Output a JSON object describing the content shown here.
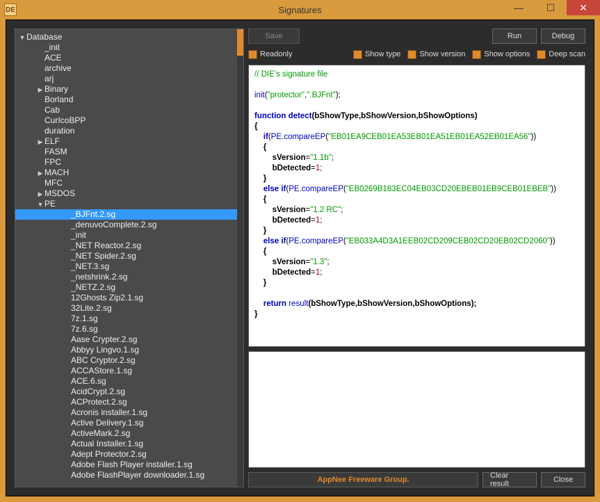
{
  "window": {
    "title": "Signatures",
    "app_icon_text": "DE"
  },
  "buttons": {
    "save": "Save",
    "run": "Run",
    "debug": "Debug",
    "clear_result": "Clear result",
    "close": "Close"
  },
  "options": {
    "readonly": "Readonly",
    "show_type": "Show type",
    "show_version": "Show version",
    "show_options": "Show options",
    "deep_scan": "Deep scan"
  },
  "status": {
    "text": "AppNee Freeware Group."
  },
  "tree": {
    "root": {
      "label": "Database",
      "expanded": true
    },
    "items": [
      {
        "label": "_init",
        "depth": 1
      },
      {
        "label": "ACE",
        "depth": 1
      },
      {
        "label": "archive",
        "depth": 1
      },
      {
        "label": "arj",
        "depth": 1
      },
      {
        "label": "Binary",
        "depth": 1,
        "expandable": true
      },
      {
        "label": "Borland",
        "depth": 1
      },
      {
        "label": "Cab",
        "depth": 1
      },
      {
        "label": "CurIcoBPP",
        "depth": 1
      },
      {
        "label": "duration",
        "depth": 1
      },
      {
        "label": "ELF",
        "depth": 1,
        "expandable": true
      },
      {
        "label": "FASM",
        "depth": 1
      },
      {
        "label": "FPC",
        "depth": 1
      },
      {
        "label": "MACH",
        "depth": 1,
        "expandable": true
      },
      {
        "label": "MFC",
        "depth": 1
      },
      {
        "label": "MSDOS",
        "depth": 1,
        "expandable": true
      },
      {
        "label": "PE",
        "depth": 1,
        "expandable": true,
        "expanded": true
      },
      {
        "label": "_BJFnt.2.sg",
        "depth": 2,
        "selected": true
      },
      {
        "label": "_denuvoComplete.2.sg",
        "depth": 2
      },
      {
        "label": "_init",
        "depth": 2
      },
      {
        "label": "_NET Reactor.2.sg",
        "depth": 2
      },
      {
        "label": "_NET Spider.2.sg",
        "depth": 2
      },
      {
        "label": "_NET.3.sg",
        "depth": 2
      },
      {
        "label": "_netshrink.2.sg",
        "depth": 2
      },
      {
        "label": "_NETZ.2.sg",
        "depth": 2
      },
      {
        "label": "12Ghosts Zip2.1.sg",
        "depth": 2
      },
      {
        "label": "32Lite.2.sg",
        "depth": 2
      },
      {
        "label": "7z.1.sg",
        "depth": 2
      },
      {
        "label": "7z.6.sg",
        "depth": 2
      },
      {
        "label": "Aase Crypter.2.sg",
        "depth": 2
      },
      {
        "label": "Abbyy Lingvo.1.sg",
        "depth": 2
      },
      {
        "label": "ABC Cryptor.2.sg",
        "depth": 2
      },
      {
        "label": "ACCAStore.1.sg",
        "depth": 2
      },
      {
        "label": "ACE.6.sg",
        "depth": 2
      },
      {
        "label": "AcidCrypt.2.sg",
        "depth": 2
      },
      {
        "label": "ACProtect.2.sg",
        "depth": 2
      },
      {
        "label": "Acronis installer.1.sg",
        "depth": 2
      },
      {
        "label": "Active Delivery.1.sg",
        "depth": 2
      },
      {
        "label": "ActiveMark.2.sg",
        "depth": 2
      },
      {
        "label": "Actual Installer.1.sg",
        "depth": 2
      },
      {
        "label": "Adept Protector.2.sg",
        "depth": 2
      },
      {
        "label": "Adobe Flash Player installer.1.sg",
        "depth": 2
      },
      {
        "label": "Adobe FlashPlayer downloader.1.sg",
        "depth": 2
      }
    ]
  },
  "code": {
    "comment": "// DIE's signature file",
    "init_args": [
      "\"protector\"",
      "\".BJFnt\""
    ],
    "func_name": "detect",
    "func_params": "bShowType,bShowVersion,bShowOptions",
    "blocks": [
      {
        "cond": "if",
        "ep": "\"EB01EA9CEB01EA53EB01EA51EB01EA52EB01EA56\"",
        "ver": "\"1.1b\""
      },
      {
        "cond": "else if",
        "ep": "\"EB0269B183EC04EB03CD20EBEB01EB9CEB01EBEB\"",
        "ver": "\"1.2 RC\""
      },
      {
        "cond": "else if",
        "ep": "\"EB033A4D3A1EEB02CD209CEB02CD20EB02CD2060\"",
        "ver": "\"1.3\""
      }
    ],
    "return_call": "result",
    "return_args": "bShowType,bShowVersion,bShowOptions"
  }
}
